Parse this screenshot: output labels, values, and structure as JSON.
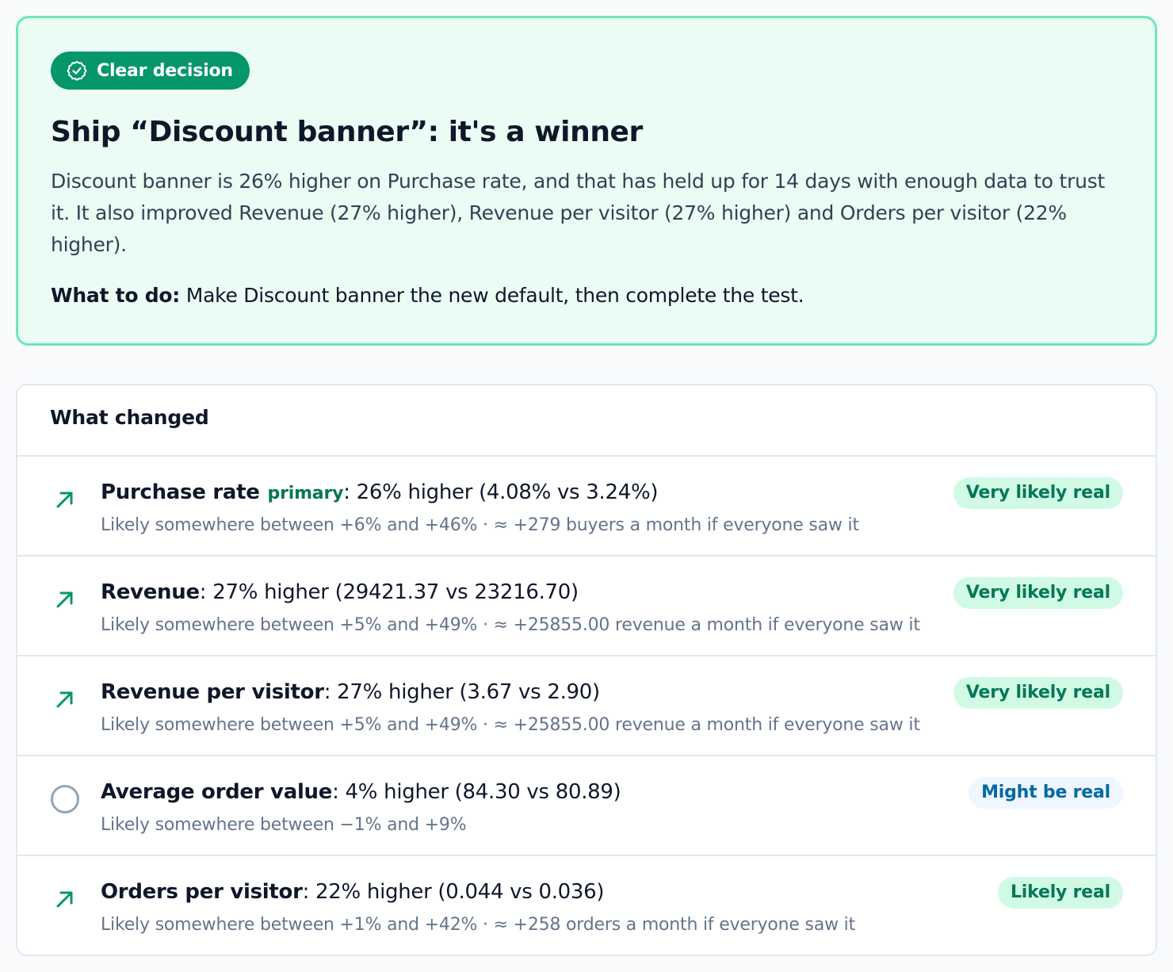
{
  "decision": {
    "pill_label": "Clear decision",
    "title": "Ship “Discount banner”: it's a winner",
    "summary": "Discount banner is 26% higher on Purchase rate, and that has held up for 14 days with enough data to trust it. It also improved Revenue (27% higher), Revenue per visitor (27% higher) and Orders per visitor (22% higher).",
    "action_label": "What to do:",
    "action_text": "Make Discount banner the new default, then complete the test.",
    "icon": "check-circle-icon",
    "accent_color": "#059669"
  },
  "changes": {
    "title": "What changed",
    "metrics": [
      {
        "name": "Purchase rate",
        "primary_tag": "primary",
        "detail": ": 26% higher (4.08% vs 3.24%)",
        "range": "Likely somewhere between +6% and +46% · ≈ +279 buyers a month if everyone saw it",
        "badge": "Very likely real",
        "trend": "up-right-arrow-icon"
      },
      {
        "name": "Revenue",
        "primary_tag": "",
        "detail": ": 27% higher (29421.37 vs 23216.70)",
        "range": "Likely somewhere between +5% and +49% · ≈ +25855.00 revenue a month if everyone saw it",
        "badge": "Very likely real",
        "trend": "up-right-arrow-icon"
      },
      {
        "name": "Revenue per visitor",
        "primary_tag": "",
        "detail": ": 27% higher (3.67 vs 2.90)",
        "range": "Likely somewhere between +5% and +49% · ≈ +25855.00 revenue a month if everyone saw it",
        "badge": "Very likely real",
        "trend": "up-right-arrow-icon"
      },
      {
        "name": "Average order value",
        "primary_tag": "",
        "detail": ": 4% higher (84.30 vs 80.89)",
        "range": "Likely somewhere between −1% and +9%",
        "badge": "Might be real",
        "trend": "neutral-circle-icon"
      },
      {
        "name": "Orders per visitor",
        "primary_tag": "",
        "detail": ": 22% higher (0.044 vs 0.036)",
        "range": "Likely somewhere between +1% and +42% · ≈ +258 orders a month if everyone saw it",
        "badge": "Likely real",
        "trend": "up-right-arrow-icon"
      }
    ]
  }
}
